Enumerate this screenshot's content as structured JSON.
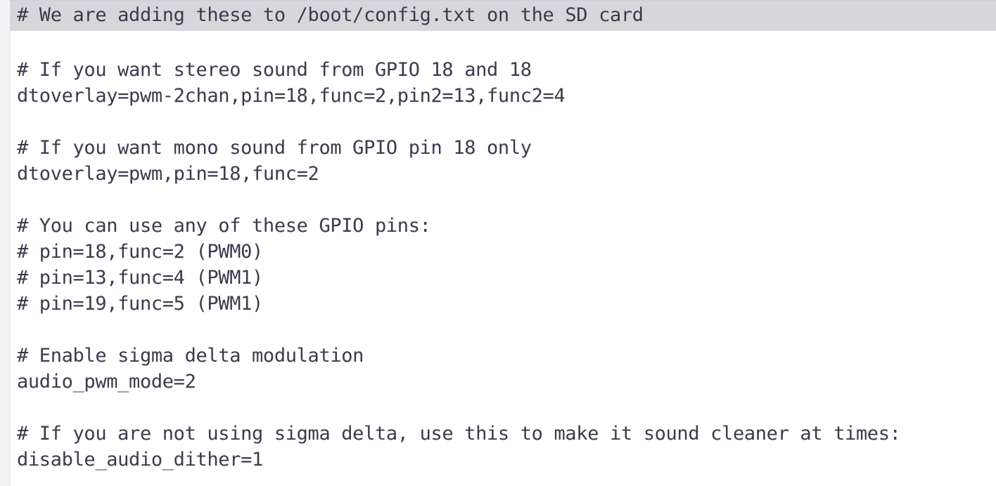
{
  "document": {
    "language": "ini",
    "description": "Raspberry Pi /boot/config.txt PWM audio configuration snippet",
    "highlighted_line_index": 0,
    "colors": {
      "background": "#ffffff",
      "text": "#3b3b4d",
      "highlight_band": "#d7d7db",
      "gutter": "#f4f2f5"
    },
    "lines": [
      {
        "text": "# We are adding these to /boot/config.txt on the SD card",
        "kind": "comment",
        "highlighted": true
      },
      {
        "text": "",
        "kind": "blank",
        "highlighted": false
      },
      {
        "text": "# If you want stereo sound from GPIO 18 and 18",
        "kind": "comment",
        "highlighted": false
      },
      {
        "text": "dtoverlay=pwm-2chan,pin=18,func=2,pin2=13,func2=4",
        "kind": "directive",
        "highlighted": false
      },
      {
        "text": "",
        "kind": "blank",
        "highlighted": false
      },
      {
        "text": "# If you want mono sound from GPIO pin 18 only",
        "kind": "comment",
        "highlighted": false
      },
      {
        "text": "dtoverlay=pwm,pin=18,func=2",
        "kind": "directive",
        "highlighted": false
      },
      {
        "text": "",
        "kind": "blank",
        "highlighted": false
      },
      {
        "text": "# You can use any of these GPIO pins:",
        "kind": "comment",
        "highlighted": false
      },
      {
        "text": "# pin=18,func=2 (PWM0)",
        "kind": "comment",
        "highlighted": false
      },
      {
        "text": "# pin=13,func=4 (PWM1)",
        "kind": "comment",
        "highlighted": false
      },
      {
        "text": "# pin=19,func=5 (PWM1)",
        "kind": "comment",
        "highlighted": false
      },
      {
        "text": "",
        "kind": "blank",
        "highlighted": false
      },
      {
        "text": "# Enable sigma delta modulation",
        "kind": "comment",
        "highlighted": false
      },
      {
        "text": "audio_pwm_mode=2",
        "kind": "directive",
        "highlighted": false
      },
      {
        "text": "",
        "kind": "blank",
        "highlighted": false
      },
      {
        "text": "# If you are not using sigma delta, use this to make it sound cleaner at times:",
        "kind": "comment",
        "highlighted": false
      },
      {
        "text": "disable_audio_dither=1",
        "kind": "directive",
        "highlighted": false
      }
    ]
  }
}
